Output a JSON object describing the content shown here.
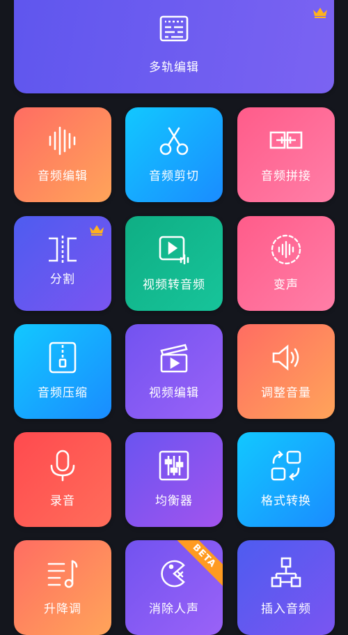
{
  "tiles": {
    "multitrack": {
      "label": "多轨编辑",
      "icon": "multitrack-editor-icon",
      "premium": true
    },
    "audio_edit": {
      "label": "音频编辑",
      "icon": "waveform-icon"
    },
    "audio_cut": {
      "label": "音频剪切",
      "icon": "scissors-icon"
    },
    "audio_join": {
      "label": "音频拼接",
      "icon": "join-icon"
    },
    "split": {
      "label": "分割",
      "icon": "split-icon",
      "premium": true
    },
    "video_to_audio": {
      "label": "视频转音频",
      "icon": "video-to-audio-icon"
    },
    "voice_change": {
      "label": "变声",
      "icon": "voice-changer-icon"
    },
    "audio_compress": {
      "label": "音频压缩",
      "icon": "zip-icon"
    },
    "video_edit": {
      "label": "视频编辑",
      "icon": "clapperboard-icon"
    },
    "volume_adjust": {
      "label": "调整音量",
      "icon": "speaker-icon"
    },
    "record": {
      "label": "录音",
      "icon": "microphone-icon"
    },
    "equalizer": {
      "label": "均衡器",
      "icon": "equalizer-icon"
    },
    "format_convert": {
      "label": "格式转换",
      "icon": "format-convert-icon"
    },
    "pitch": {
      "label": "升降调",
      "icon": "pitch-icon"
    },
    "vocal_remove": {
      "label": "消除人声",
      "icon": "vocal-remove-icon",
      "badge": "BETA"
    },
    "insert_audio": {
      "label": "插入音频",
      "icon": "insert-audio-icon"
    }
  },
  "colors": {
    "crown": "#ffb21e",
    "background": "#14161d"
  }
}
